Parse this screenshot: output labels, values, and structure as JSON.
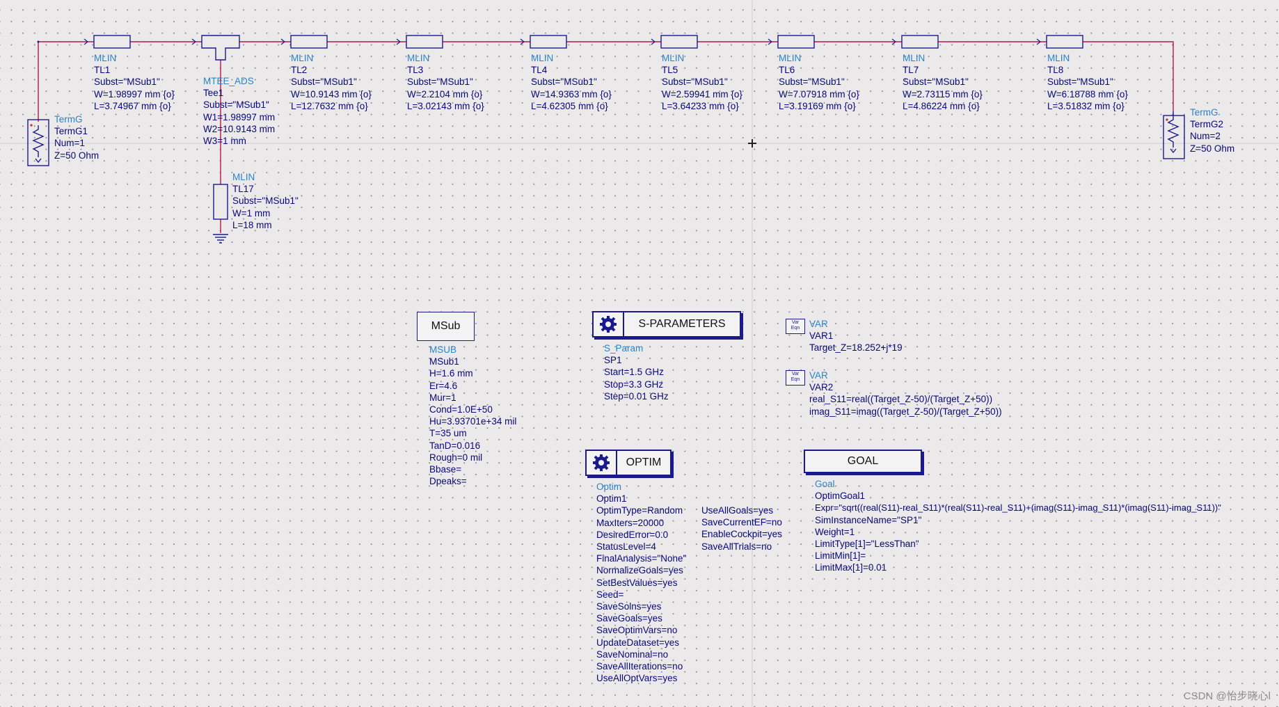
{
  "components": {
    "termg1": {
      "lines": [
        "TermG",
        "TermG1",
        "Num=1",
        "Z=50 Ohm"
      ]
    },
    "tl1": {
      "lines": [
        "MLIN",
        "TL1",
        "Subst=\"MSub1\"",
        "W=1.98997 mm {o}",
        "L=3.74967 mm {o}"
      ]
    },
    "tee1": {
      "lines": [
        "MTEE_ADS",
        "Tee1",
        "Subst=\"MSub1\"",
        "W1=1.98997 mm",
        "W2=10.9143 mm",
        "W3=1 mm"
      ]
    },
    "tl2": {
      "lines": [
        "MLIN",
        "TL2",
        "Subst=\"MSub1\"",
        "W=10.9143 mm {o}",
        "L=12.7632 mm {o}"
      ]
    },
    "tl3": {
      "lines": [
        "MLIN",
        "TL3",
        "Subst=\"MSub1\"",
        "W=2.2104 mm {o}",
        "L=3.02143 mm {o}"
      ]
    },
    "tl4": {
      "lines": [
        "MLIN",
        "TL4",
        "Subst=\"MSub1\"",
        "W=14.9363 mm {o}",
        "L=4.62305 mm {o}"
      ]
    },
    "tl5": {
      "lines": [
        "MLIN",
        "TL5",
        "Subst=\"MSub1\"",
        "W=2.59941 mm {o}",
        "L=3.64233 mm {o}"
      ]
    },
    "tl6": {
      "lines": [
        "MLIN",
        "TL6",
        "Subst=\"MSub1\"",
        "W=7.07918 mm {o}",
        "L=3.19169 mm {o}"
      ]
    },
    "tl7": {
      "lines": [
        "MLIN",
        "TL7",
        "Subst=\"MSub1\"",
        "W=2.73115 mm {o}",
        "L=4.86224 mm {o}"
      ]
    },
    "tl8": {
      "lines": [
        "MLIN",
        "TL8",
        "Subst=\"MSub1\"",
        "W=6.18788 mm {o}",
        "L=3.51832 mm {o}"
      ]
    },
    "termg2": {
      "lines": [
        "TermG",
        "TermG2",
        "Num=2",
        "Z=50 Ohm"
      ]
    },
    "tl17": {
      "lines": [
        "MLIN",
        "TL17",
        "Subst=\"MSub1\"",
        "W=1 mm",
        "L=18 mm"
      ]
    },
    "msub": {
      "box_label": "MSub",
      "lines": [
        "MSUB",
        "MSub1",
        "H=1.6 mm",
        "Er=4.6",
        "Mur=1",
        "Cond=1.0E+50",
        "Hu=3.93701e+34 mil",
        "T=35 um",
        "TanD=0.016",
        "Rough=0 mil",
        "Bbase=",
        "Dpeaks="
      ]
    },
    "sparams": {
      "box_label": "S-PARAMETERS",
      "lines": [
        "S_Param",
        "SP1",
        "Start=1.5 GHz",
        "Stop=3.3 GHz",
        "Step=0.01 GHz"
      ]
    },
    "var1": {
      "icon_text": [
        "Var",
        "Eqn"
      ],
      "lines": [
        "VAR",
        "VAR1",
        "Target_Z=18.252+j*19"
      ]
    },
    "var2": {
      "icon_text": [
        "Var",
        "Eqn"
      ],
      "lines": [
        "VAR",
        "VAR2",
        "real_S11=real((Target_Z-50)/(Target_Z+50))",
        "imag_S11=imag((Target_Z-50)/(Target_Z+50))"
      ]
    },
    "optim": {
      "box_label": "OPTIM",
      "lines": [
        "Optim",
        "Optim1",
        "OptimType=Random",
        "MaxIters=20000",
        "DesiredError=0.0",
        "StatusLevel=4",
        "FinalAnalysis=\"None\"",
        "NormalizeGoals=yes",
        "SetBestValues=yes",
        "Seed=",
        "SaveSolns=yes",
        "SaveGoals=yes",
        "SaveOptimVars=no",
        "UpdateDataset=yes",
        "SaveNominal=no",
        "SaveAllIterations=no",
        "UseAllOptVars=yes"
      ],
      "lines_col2": [
        "UseAllGoals=yes",
        "SaveCurrentEF=no",
        "EnableCockpit=yes",
        "SaveAllTrials=no"
      ]
    },
    "goal": {
      "box_label": "GOAL",
      "lines": [
        "Goal",
        "OptimGoal1",
        "Expr=\"sqrt((real(S11)-real_S11)*(real(S11)-real_S11)+(imag(S11)-imag_S11)*(imag(S11)-imag_S11))\"",
        "SimInstanceName=\"SP1\"",
        "Weight=1",
        "LimitType[1]=\"LessThan\"",
        "LimitMin[1]=",
        "LimitMax[1]=0.01"
      ]
    }
  },
  "watermark": "CSDN @怡步晓心l",
  "colors": {
    "wire": "#b3174e",
    "component": "#1a1a8c",
    "header_text": "#2a84c9",
    "param_text": "#08087a",
    "background": "#ebe9e9"
  }
}
